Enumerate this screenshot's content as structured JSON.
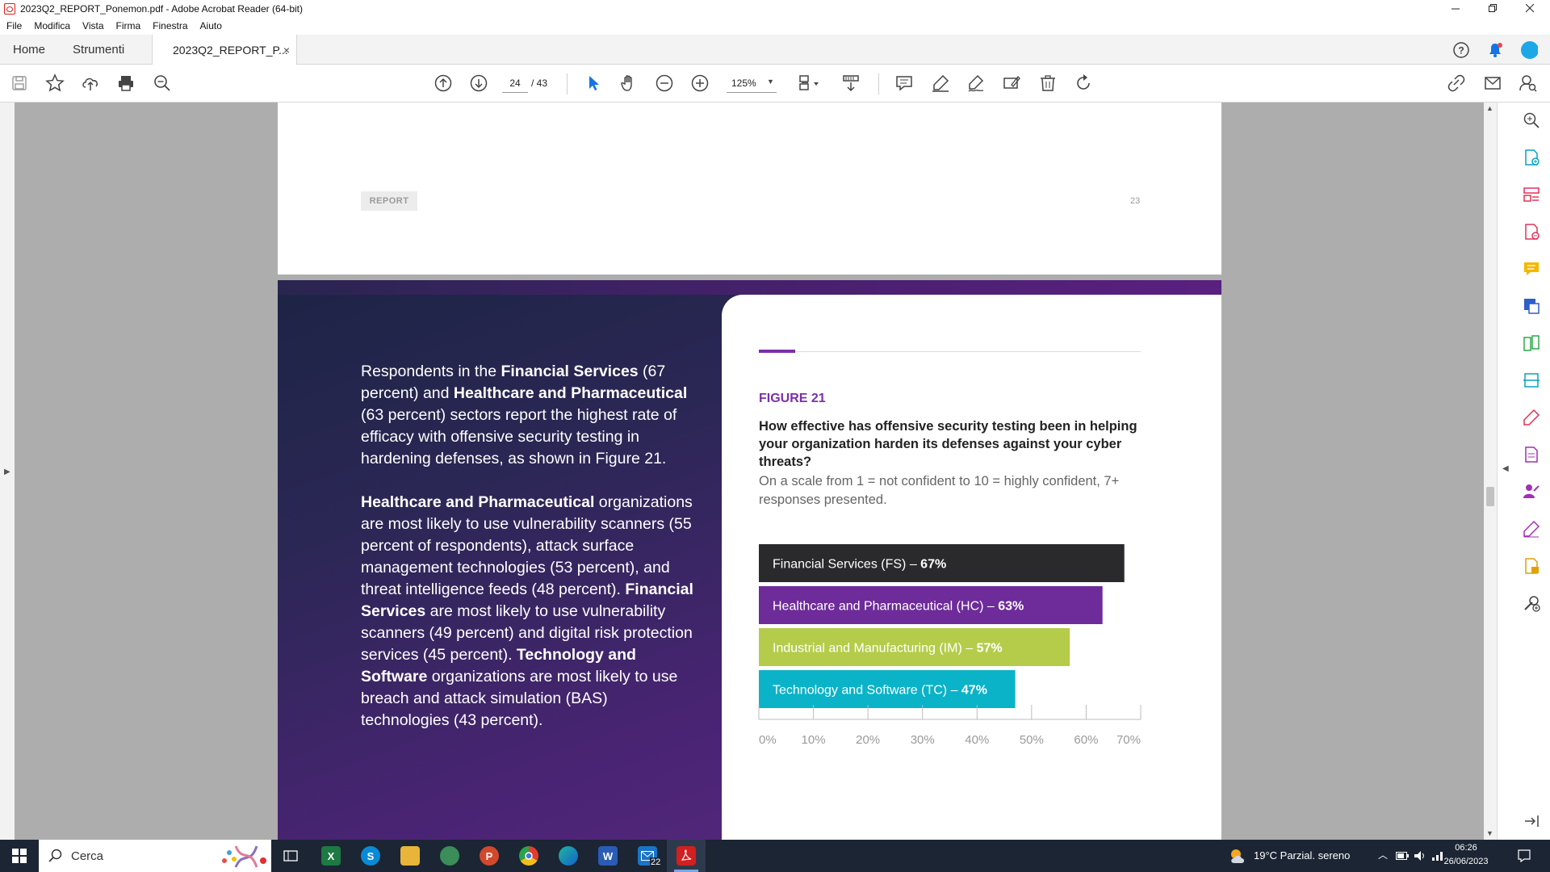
{
  "window": {
    "title": "2023Q2_REPORT_Ponemon.pdf - Adobe Acrobat Reader (64-bit)",
    "controls": [
      "minimize-icon",
      "restore-icon",
      "close-icon"
    ]
  },
  "menu": [
    "File",
    "Modifica",
    "Vista",
    "Firma",
    "Finestra",
    "Aiuto"
  ],
  "tabs": {
    "home": "Home",
    "tools": "Strumenti",
    "document": "2023Q2_REPORT_P...",
    "close": "×"
  },
  "toolbar": {
    "current_page": "24",
    "total_pages": "/ 43",
    "zoom": "125%"
  },
  "page_prev": {
    "tag": "REPORT",
    "page_number": "23"
  },
  "page": {
    "paragraph1": {
      "t1": "Respondents in the ",
      "b1": "Financial Services",
      "t2": " (67 percent) and ",
      "b2": "Healthcare and Pharmaceutical",
      "t3": " (63 percent) sectors report the highest rate of efficacy with offensive security testing in hardening defenses, as shown in Figure 21."
    },
    "paragraph2": {
      "b1": "Healthcare and Pharmaceutical",
      "t1": " organizations are most likely to use vulnerability scanners (55 percent of respondents), attack surface management technologies (53 percent), and threat intelligence feeds (48 percent). ",
      "b2": "Financial Services",
      "t2": " are most likely to use vulnerability scanners (49 percent) and digital risk protection services (45 percent). ",
      "b3": "Technology and Software",
      "t3": " organizations are most likely to use breach and attack simulation (BAS) technologies (43 percent)."
    },
    "figure_label": "FIGURE 21",
    "figure_question": "How effective has offensive security testing been in helping your organization harden its defenses against your cyber threats?",
    "figure_sub": "On a scale from 1 = not confident to 10 = highly confident, 7+ responses presented."
  },
  "chart_data": {
    "type": "bar",
    "orientation": "horizontal",
    "categories": [
      "Financial Services (FS)",
      "Healthcare and Pharmaceutical (HC)",
      "Industrial and Manufacturing (IM)",
      "Technology and Software (TC)"
    ],
    "values": [
      67,
      63,
      57,
      47
    ],
    "value_labels": [
      "67%",
      "63%",
      "57%",
      "47%"
    ],
    "colors": [
      "#2a2a2c",
      "#6e2b9a",
      "#b5cc4a",
      "#0ab3c8"
    ],
    "xlim": [
      0,
      70
    ],
    "ticks": [
      "0%",
      "10%",
      "20%",
      "30%",
      "40%",
      "50%",
      "60%",
      "70%"
    ],
    "grid": false
  },
  "taskbar": {
    "search": "Cerca",
    "weather": "19°C  Parzial. sereno",
    "time": "06:26",
    "date": "26/06/2023",
    "mail_badge": "22"
  },
  "colors": {
    "accent_purple": "#7b2fa8",
    "viewer_bg": "#adadad",
    "taskbar_bg": "#1b2533"
  }
}
